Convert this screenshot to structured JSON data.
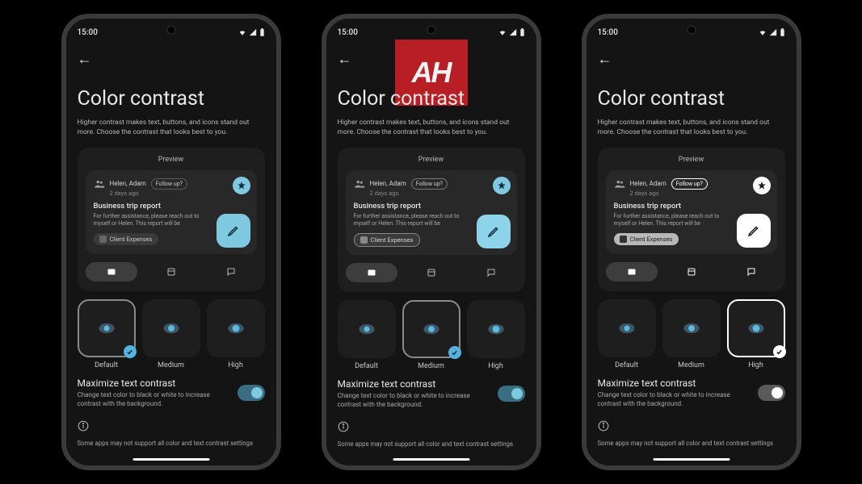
{
  "statusbar": {
    "time": "15:00"
  },
  "header": {
    "title": "Color contrast"
  },
  "subtitle": "Higher contrast makes text, buttons, and icons stand out more. Choose the contrast that looks best to you.",
  "preview": {
    "label": "Preview",
    "from": "Helen, Adam",
    "time": "2 days ago",
    "followup": "Follow up?",
    "subject": "Business trip report",
    "body": "For further assistance, please reach out to myself or Helen. This report will be",
    "attachment": "Client Expenses"
  },
  "options": {
    "0": {
      "label": "Default"
    },
    "1": {
      "label": "Medium"
    },
    "2": {
      "label": "High"
    }
  },
  "maximize": {
    "title": "Maximize text contrast",
    "subtitle": "Change text color to black or white to increase contrast with the background."
  },
  "footer": "Some apps may not support all color and text contrast settings",
  "variants": {
    "0": {
      "selected": "Default",
      "accent": "blue",
      "star_bg": "blue",
      "fab_bg": "blue"
    },
    "1": {
      "selected": "Medium",
      "accent": "blue",
      "star_bg": "blue",
      "fab_bg": "bluelight"
    },
    "2": {
      "selected": "High",
      "accent": "white",
      "star_bg": "white",
      "fab_bg": "white"
    }
  },
  "watermark": "AH"
}
